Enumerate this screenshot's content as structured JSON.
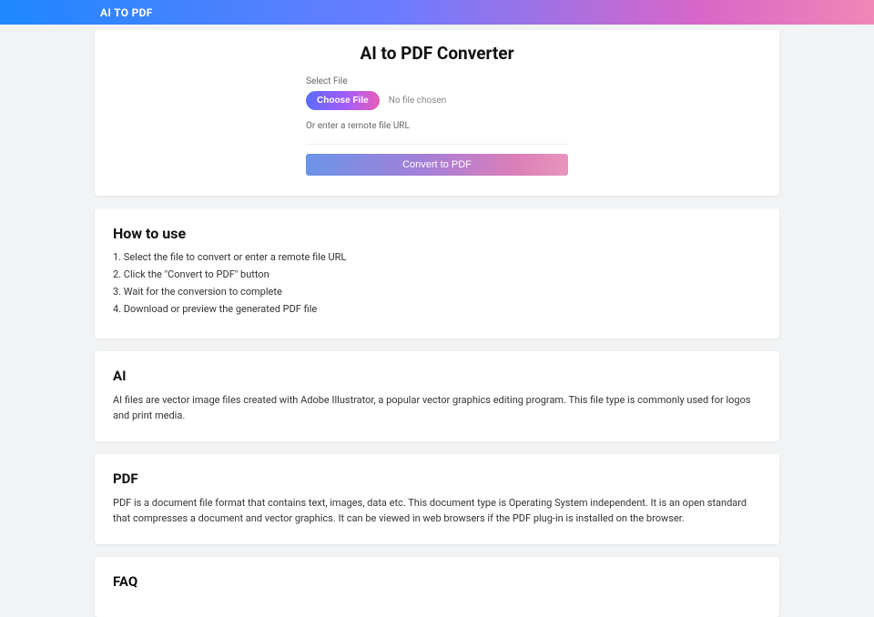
{
  "header": {
    "title": "AI TO PDF"
  },
  "converter": {
    "title": "AI to PDF Converter",
    "select_label": "Select File",
    "choose_button": "Choose File",
    "file_status": "No file chosen",
    "remote_label": "Or enter a remote file URL",
    "convert_button": "Convert to PDF"
  },
  "howto": {
    "heading": "How to use",
    "steps": [
      "1. Select the file to convert or enter a remote file URL",
      "2. Click the \"Convert to PDF\" button",
      "3. Wait for the conversion to complete",
      "4. Download or preview the generated PDF file"
    ]
  },
  "ai_section": {
    "heading": "AI",
    "body": "AI files are vector image files created with Adobe Illustrator, a popular vector graphics editing program. This file type is commonly used for logos and print media."
  },
  "pdf_section": {
    "heading": "PDF",
    "body": "PDF is a document file format that contains text, images, data etc. This document type is Operating System independent. It is an open standard that compresses a document and vector graphics. It can be viewed in web browsers if the PDF plug-in is installed on the browser."
  },
  "faq": {
    "heading": "FAQ"
  }
}
